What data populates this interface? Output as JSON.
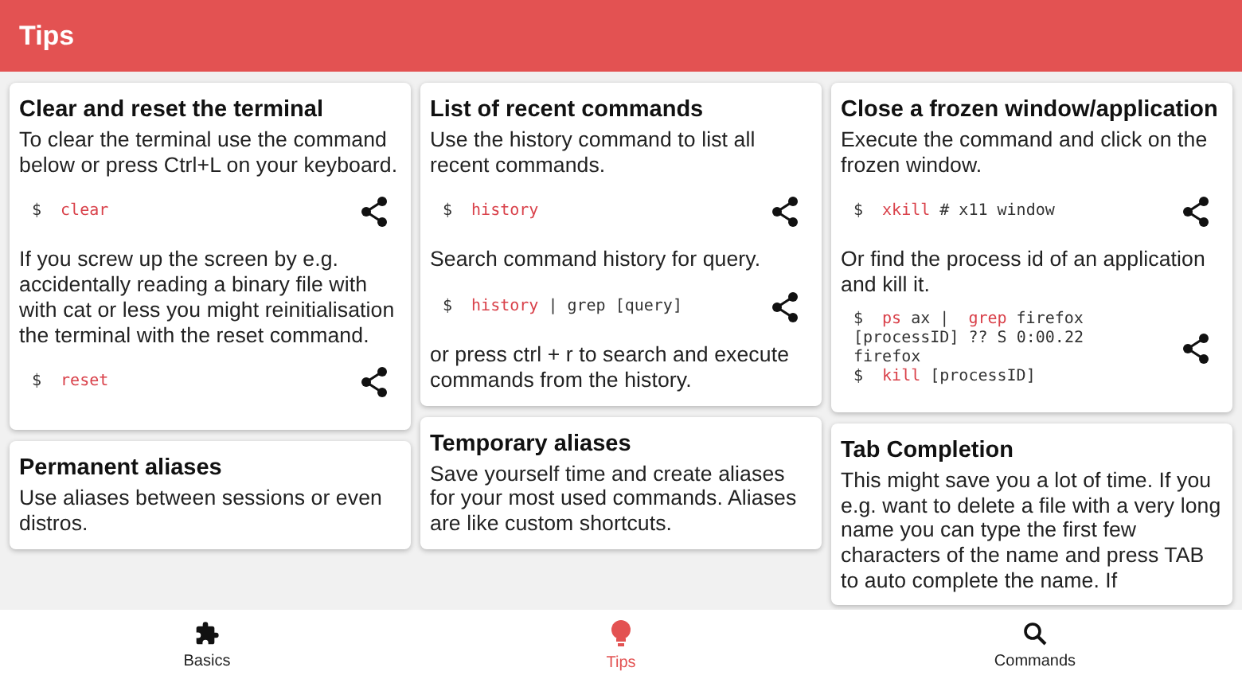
{
  "app_bar": {
    "title": "Tips"
  },
  "columns": [
    {
      "cards": [
        {
          "title": "Clear and reset the terminal",
          "blocks": [
            {
              "kind": "text",
              "text": "To clear the terminal use the command below or press Ctrl+L on your keyboard."
            },
            {
              "kind": "code",
              "lines": [
                [
                  {
                    "kind": "prompt",
                    "text": "$"
                  },
                  {
                    "kind": "cmd",
                    "text": "clear"
                  }
                ]
              ]
            },
            {
              "kind": "text",
              "text": "If you screw up the screen by e.g. accidentally reading a binary file with with cat or less you might reinitialisation the terminal with the reset command."
            },
            {
              "kind": "code",
              "lines": [
                [
                  {
                    "kind": "prompt",
                    "text": "$"
                  },
                  {
                    "kind": "cmd",
                    "text": "reset"
                  }
                ]
              ]
            }
          ]
        },
        {
          "title": "Permanent aliases",
          "blocks": [
            {
              "kind": "text",
              "text": "Use aliases between sessions or even distros."
            }
          ]
        }
      ]
    },
    {
      "cards": [
        {
          "title": "List of recent commands",
          "blocks": [
            {
              "kind": "text",
              "text": "Use the history command to list all recent commands."
            },
            {
              "kind": "code",
              "lines": [
                [
                  {
                    "kind": "prompt",
                    "text": "$"
                  },
                  {
                    "kind": "cmd",
                    "text": "history"
                  }
                ]
              ]
            },
            {
              "kind": "text",
              "text": "Search command history for query."
            },
            {
              "kind": "code",
              "lines": [
                [
                  {
                    "kind": "prompt",
                    "text": "$"
                  },
                  {
                    "kind": "cmd",
                    "text": "history"
                  },
                  {
                    "kind": "arg",
                    "text": "| grep [query]"
                  }
                ]
              ]
            },
            {
              "kind": "text",
              "text": "or press ctrl + r to search and execute commands from the history."
            }
          ]
        },
        {
          "title": "Temporary aliases",
          "blocks": [
            {
              "kind": "text",
              "text": "Save yourself time and create aliases for your most used commands. Aliases are like custom shortcuts."
            }
          ]
        }
      ]
    },
    {
      "cards": [
        {
          "title": "Close a frozen window/application",
          "blocks": [
            {
              "kind": "text",
              "text": "Execute the command and click on the frozen window."
            },
            {
              "kind": "code",
              "lines": [
                [
                  {
                    "kind": "prompt",
                    "text": "$"
                  },
                  {
                    "kind": "cmd",
                    "text": "xkill"
                  },
                  {
                    "kind": "arg",
                    "text": "# x11 window"
                  }
                ]
              ]
            },
            {
              "kind": "text",
              "text": "Or find the process id of an application and kill it."
            },
            {
              "kind": "code",
              "lines": [
                [
                  {
                    "kind": "prompt",
                    "text": "$"
                  },
                  {
                    "kind": "cmd",
                    "text": "ps"
                  },
                  {
                    "kind": "arg",
                    "text": "ax |"
                  },
                  {
                    "kind": "cmd",
                    "text": " grep"
                  },
                  {
                    "kind": "arg",
                    "text": "firefox"
                  }
                ],
                [
                  {
                    "kind": "arg",
                    "text": "[processID] ?? S 0:00.22"
                  }
                ],
                [
                  {
                    "kind": "arg",
                    "text": "firefox"
                  }
                ],
                [
                  {
                    "kind": "prompt",
                    "text": "$"
                  },
                  {
                    "kind": "cmd",
                    "text": "kill"
                  },
                  {
                    "kind": "arg",
                    "text": "[processID]"
                  }
                ]
              ]
            }
          ]
        },
        {
          "title": "Tab Completion",
          "blocks": [
            {
              "kind": "text",
              "text": "This might save you a lot of time. If you e.g. want to delete a file with a very long name you can type the first few characters of the name and press TAB to auto complete the name. If"
            }
          ]
        }
      ]
    }
  ],
  "bottom_nav": [
    {
      "label": "Basics",
      "selected": false
    },
    {
      "label": "Tips",
      "selected": true
    },
    {
      "label": "Commands",
      "selected": false
    }
  ]
}
